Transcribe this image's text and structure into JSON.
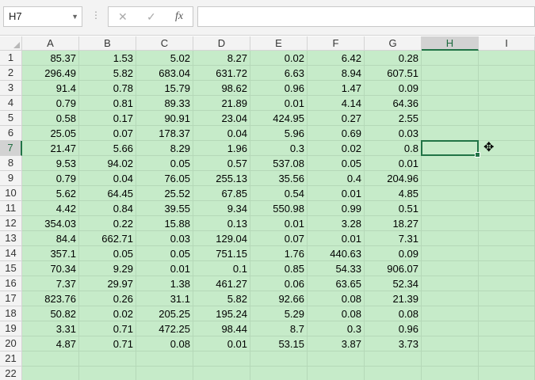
{
  "toolbar": {
    "name_box": "H7",
    "cancel_icon": "✕",
    "enter_icon": "✓",
    "fx_label": "fx",
    "formula_value": ""
  },
  "columns": [
    "A",
    "B",
    "C",
    "D",
    "E",
    "F",
    "G",
    "H",
    "I"
  ],
  "selected_cell": {
    "column": "H",
    "row": 7
  },
  "rows": [
    [
      "1",
      "85.37",
      "1.53",
      "5.02",
      "8.27",
      "0.02",
      "6.42",
      "0.28"
    ],
    [
      "2",
      "296.49",
      "5.82",
      "683.04",
      "631.72",
      "6.63",
      "8.94",
      "607.51"
    ],
    [
      "3",
      "91.4",
      "0.78",
      "15.79",
      "98.62",
      "0.96",
      "1.47",
      "0.09"
    ],
    [
      "4",
      "0.79",
      "0.81",
      "89.33",
      "21.89",
      "0.01",
      "4.14",
      "64.36"
    ],
    [
      "5",
      "0.58",
      "0.17",
      "90.91",
      "23.04",
      "424.95",
      "0.27",
      "2.55"
    ],
    [
      "6",
      "25.05",
      "0.07",
      "178.37",
      "0.04",
      "5.96",
      "0.69",
      "0.03"
    ],
    [
      "7",
      "21.47",
      "5.66",
      "8.29",
      "1.96",
      "0.3",
      "0.02",
      "0.8"
    ],
    [
      "8",
      "9.53",
      "94.02",
      "0.05",
      "0.57",
      "537.08",
      "0.05",
      "0.01"
    ],
    [
      "9",
      "0.79",
      "0.04",
      "76.05",
      "255.13",
      "35.56",
      "0.4",
      "204.96"
    ],
    [
      "10",
      "5.62",
      "64.45",
      "25.52",
      "67.85",
      "0.54",
      "0.01",
      "4.85"
    ],
    [
      "11",
      "4.42",
      "0.84",
      "39.55",
      "9.34",
      "550.98",
      "0.99",
      "0.51"
    ],
    [
      "12",
      "354.03",
      "0.22",
      "15.88",
      "0.13",
      "0.01",
      "3.28",
      "18.27"
    ],
    [
      "13",
      "84.4",
      "662.71",
      "0.03",
      "129.04",
      "0.07",
      "0.01",
      "7.31"
    ],
    [
      "14",
      "357.1",
      "0.05",
      "0.05",
      "751.15",
      "1.76",
      "440.63",
      "0.09"
    ],
    [
      "15",
      "70.34",
      "9.29",
      "0.01",
      "0.1",
      "0.85",
      "54.33",
      "906.07"
    ],
    [
      "16",
      "7.37",
      "29.97",
      "1.38",
      "461.27",
      "0.06",
      "63.65",
      "52.34"
    ],
    [
      "17",
      "823.76",
      "0.26",
      "31.1",
      "5.82",
      "92.66",
      "0.08",
      "21.39"
    ],
    [
      "18",
      "50.82",
      "0.02",
      "205.25",
      "195.24",
      "5.29",
      "0.08",
      "0.08"
    ],
    [
      "19",
      "3.31",
      "0.71",
      "472.25",
      "98.44",
      "8.7",
      "0.3",
      "0.96"
    ],
    [
      "20",
      "4.87",
      "0.71",
      "0.08",
      "0.01",
      "53.15",
      "3.87",
      "3.73"
    ],
    [
      "21",
      "",
      "",
      "",
      "",
      "",
      "",
      ""
    ],
    [
      "22",
      "",
      "",
      "",
      "",
      "",
      "",
      ""
    ]
  ]
}
